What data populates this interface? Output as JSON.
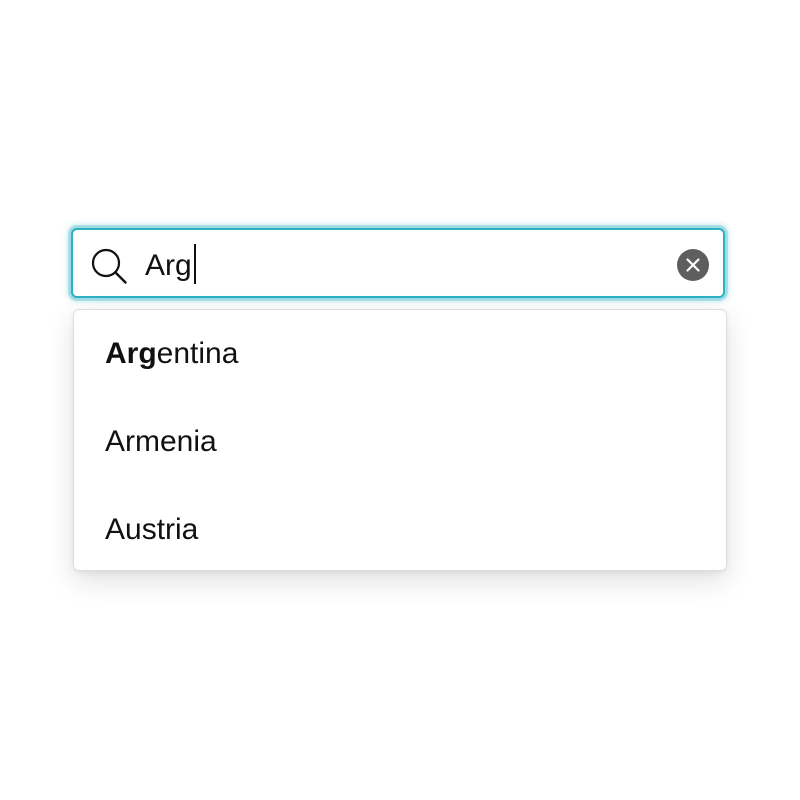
{
  "search": {
    "query": "Arg",
    "placeholder": "",
    "icon": "search-icon",
    "clear_icon": "close-icon"
  },
  "colors": {
    "focus_ring": "#2fb1c4",
    "clear_button": "#5e5e5e",
    "text": "#111111"
  },
  "options": [
    {
      "match": "Arg",
      "rest": "entina"
    },
    {
      "match": "",
      "rest": "Armenia"
    },
    {
      "match": "",
      "rest": "Austria"
    }
  ]
}
